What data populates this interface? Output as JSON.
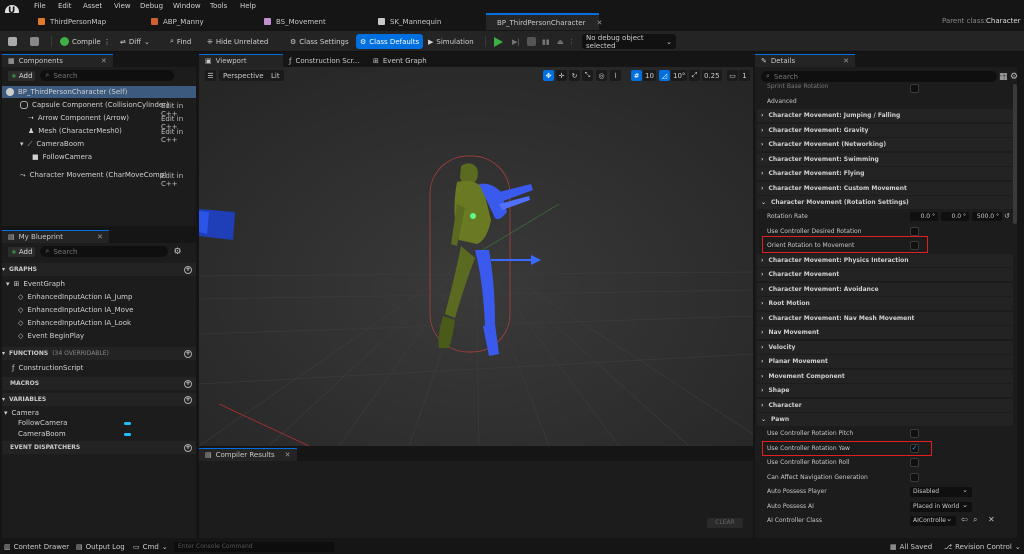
{
  "menu": [
    "File",
    "Edit",
    "Asset",
    "View",
    "Debug",
    "Window",
    "Tools",
    "Help"
  ],
  "tabs": [
    {
      "label": "ThirdPersonMap",
      "color": "#e07a2a"
    },
    {
      "label": "ABP_Manny",
      "color": "#d06030"
    },
    {
      "label": "BS_Movement",
      "color": "#c090d0"
    },
    {
      "label": "SK_Mannequin",
      "color": "#c8c8c8"
    },
    {
      "label": "BP_ThirdPersonCharacter",
      "color": "#3aa0f0"
    }
  ],
  "parent_class_label": "Parent class:",
  "parent_class_value": "Character",
  "toolbar": {
    "compile": "Compile",
    "diff": "Diff",
    "find": "Find",
    "hide_unrelated": "Hide Unrelated",
    "class_settings": "Class Settings",
    "class_defaults": "Class Defaults",
    "simulation": "Simulation",
    "debug_select": "No debug object selected"
  },
  "components": {
    "tab": "Components",
    "add": "Add",
    "search_placeholder": "Search",
    "root": "BP_ThirdPersonCharacter (Self)",
    "items": [
      {
        "label": "Capsule Component (CollisionCylinder)",
        "edit": "Edit in C++"
      },
      {
        "label": "Arrow Component (Arrow)",
        "edit": "Edit in C++"
      },
      {
        "label": "Mesh (CharacterMesh0)",
        "edit": "Edit in C++"
      },
      {
        "label": "CameraBoom",
        "edit": ""
      },
      {
        "label": "FollowCamera",
        "edit": ""
      },
      {
        "label": "Character Movement (CharMoveComp)",
        "edit": "Edit in C++"
      }
    ]
  },
  "blueprint": {
    "tab": "My Blueprint",
    "add": "Add",
    "search_placeholder": "Search",
    "graphs_header": "GRAPHS",
    "event_graph": "EventGraph",
    "events": [
      "EnhancedInputAction IA_Jump",
      "EnhancedInputAction IA_Move",
      "EnhancedInputAction IA_Look",
      "Event BeginPlay"
    ],
    "functions_header": "FUNCTIONS",
    "functions_count": "(34 OVERRIDABLE)",
    "construction": "ConstructionScript",
    "macros_header": "MACROS",
    "variables_header": "VARIABLES",
    "var_category": "Camera",
    "variables": [
      "FollowCamera",
      "CameraBoom"
    ],
    "dispatchers_header": "EVENT DISPATCHERS"
  },
  "editor_tabs": [
    "Viewport",
    "Construction Scr...",
    "Event Graph"
  ],
  "viewport": {
    "perspective": "Perspective",
    "lit": "Lit",
    "grid_snap": "10",
    "rot_snap": "10°",
    "scale_snap": "0.25",
    "cam_speed": "1"
  },
  "compiler": {
    "tab": "Compiler Results",
    "clear": "CLEAR"
  },
  "details": {
    "tab": "Details",
    "search_placeholder": "Search",
    "partial_top": "Sprint Base Rotation",
    "advanced": "Advanced",
    "categories_a": [
      "Character Movement: Jumping / Falling",
      "Character Movement: Gravity",
      "Character Movement (Networking)",
      "Character Movement: Swimming",
      "Character Movement: Flying",
      "Character Movement: Custom Movement",
      "Character Movement (Rotation Settings)"
    ],
    "rotation_rate": "Rotation Rate",
    "rotation_values": [
      "0.0 °",
      "0.0 °",
      "500.0 °"
    ],
    "use_controller_desired": "Use Controller Desired Rotation",
    "orient_rotation": "Orient Rotation to Movement",
    "categories_b": [
      "Character Movement: Physics Interaction",
      "Character Movement",
      "Character Movement: Avoidance",
      "Root Motion",
      "Character Movement: Nav Mesh Movement",
      "Nav Movement",
      "Velocity",
      "Planar Movement",
      "Movement Component",
      "Shape",
      "Character",
      "Pawn"
    ],
    "pawn_props": [
      {
        "label": "Use Controller Rotation Pitch",
        "checked": false
      },
      {
        "label": "Use Controller Rotation Yaw",
        "checked": true
      },
      {
        "label": "Use Controller Rotation Roll",
        "checked": false
      },
      {
        "label": "Can Affect Navigation Generation",
        "checked": false
      }
    ],
    "auto_possess_player": "Auto Possess Player",
    "auto_possess_player_value": "Disabled",
    "auto_possess_ai": "Auto Possess AI",
    "auto_possess_ai_value": "Placed in World",
    "ai_controller_class": "AI Controller Class",
    "ai_controller_value": "AIControlle"
  },
  "status": {
    "content_drawer": "Content Drawer",
    "output_log": "Output Log",
    "cmd": "Cmd",
    "console_placeholder": "Enter Console Command",
    "all_saved": "All Saved",
    "revision_control": "Revision Control"
  }
}
